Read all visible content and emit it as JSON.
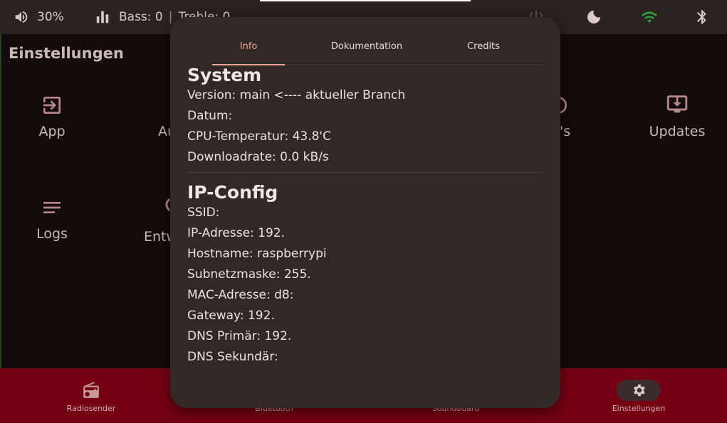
{
  "statusbar": {
    "volume": "30%",
    "bass_label": "Bass: 0",
    "separator": "|",
    "treble_label": "Treble: 0"
  },
  "page": {
    "title": "Einstellungen",
    "tiles": [
      {
        "label": "App",
        "icon": "exit-to-app-icon"
      },
      {
        "label": "Au",
        "icon": "audio-icon"
      },
      {
        "label": "'s",
        "icon": "hidden-icon"
      },
      {
        "label": "Updates",
        "icon": "system-update-icon"
      },
      {
        "label": "Logs",
        "icon": "notes-icon"
      },
      {
        "label": "Entw",
        "icon": "developer-icon"
      }
    ]
  },
  "bottomnav": {
    "items": [
      {
        "label": "Radiosender",
        "icon": "radio-icon"
      },
      {
        "label": "Bluetooth",
        "icon": "bluetooth-icon"
      },
      {
        "label": "Soundboard",
        "icon": "soundboard-icon"
      },
      {
        "label": "Einstellungen",
        "icon": "gear-icon"
      }
    ]
  },
  "dialog": {
    "tabs": [
      "Info",
      "Dokumentation",
      "Credits"
    ],
    "system": {
      "heading": "System",
      "version": "Version: main <---- aktueller Branch",
      "date": "Datum:",
      "cpu": "CPU-Temperatur: 43.8'C",
      "download": "Downloadrate: 0.0 kB/s"
    },
    "ip": {
      "heading": "IP-Config",
      "ssid": "SSID:",
      "address": "IP-Adresse: 192.",
      "hostname": "Hostname: raspberrypi",
      "subnet": "Subnetzmaske: 255.",
      "mac": "MAC-Adresse: d8:",
      "gateway": "Gateway: 192.",
      "dns1": "DNS Primär: 192.",
      "dns2": "DNS Sekundär:"
    }
  },
  "colors": {
    "accent": "#f0a99c",
    "nav_bg": "#740012",
    "dialog_bg": "#322826",
    "wifi": "#2e9b3a"
  }
}
